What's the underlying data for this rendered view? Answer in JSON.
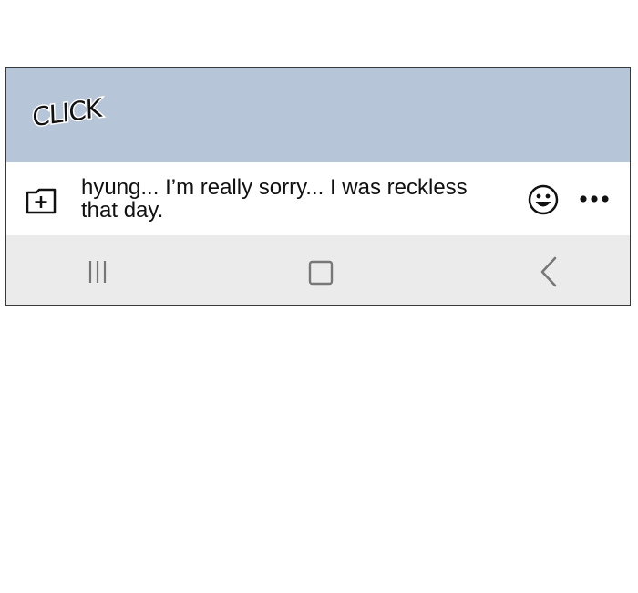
{
  "sound_effect": "CLICK",
  "chat_input": {
    "message": "hyung... I’m really sorry... I was reckless that day."
  },
  "icons": {
    "attach": "folder-plus-icon",
    "emoji": "smiley-icon",
    "more": "more-dots-icon",
    "nav_recent": "recent-apps-icon",
    "nav_home": "home-icon",
    "nav_back": "back-icon"
  },
  "colors": {
    "sky_panel": "#b6c5d7",
    "nav_bar": "#ebebeb",
    "text": "#111111"
  }
}
